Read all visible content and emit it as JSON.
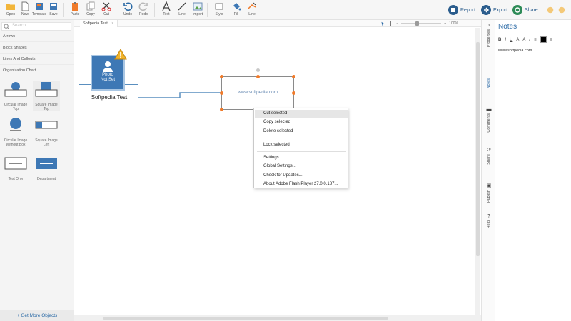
{
  "toolbar": {
    "buttons": [
      {
        "label": "Open"
      },
      {
        "label": "New"
      },
      {
        "label": "Template"
      },
      {
        "label": "Save"
      },
      {
        "label": "Paste"
      },
      {
        "label": "Copy"
      },
      {
        "label": "Cut"
      },
      {
        "label": "Undo"
      },
      {
        "label": "Redo"
      },
      {
        "label": "Text"
      },
      {
        "label": "Line"
      },
      {
        "label": "Import"
      },
      {
        "label": "Style"
      },
      {
        "label": "Fill"
      },
      {
        "label": "Line"
      }
    ],
    "report_label": "Report",
    "export_label": "Export",
    "share_label": "Share"
  },
  "left_panel": {
    "search_placeholder": "Search",
    "categories": [
      "Arrows",
      "Block Shapes",
      "Lines And Callouts",
      "Organization Chart"
    ],
    "shapes": [
      {
        "caption": "Circular Image Top"
      },
      {
        "caption": "Square Image Top"
      },
      {
        "caption": "Circular Image Without Box"
      },
      {
        "caption": "Square Image Left"
      },
      {
        "caption": "Text Only"
      },
      {
        "caption": "Department"
      }
    ],
    "get_more": "+ Get More Objects"
  },
  "tabs": {
    "doc_tab": "Softpedia Test",
    "zoom_text": "100%"
  },
  "canvas": {
    "node_name": "Softpedia Test",
    "photo_text": "Photo\nNot Set",
    "selected_text": "www.softpedia.com"
  },
  "context_menu": {
    "items": [
      "Cut selected",
      "Copy selected",
      "Delete selected",
      "Lock selected",
      "Settings...",
      "Global Settings...",
      "Check for Updates...",
      "About Adobe Flash Player 27.0.0.187..."
    ]
  },
  "side_tabs": [
    "Properties",
    "Notes",
    "Comments",
    "Share",
    "Publish",
    "Help"
  ],
  "notes_panel": {
    "title": "Notes",
    "tools": [
      "B",
      "I",
      "U",
      "A",
      "A",
      "/"
    ],
    "body": "www.softpedia.com"
  },
  "colors": {
    "accent": "#2b6aa6",
    "handle": "#f07b2b",
    "photo_bg": "#3e78b5",
    "warning": "#f2b52b"
  }
}
